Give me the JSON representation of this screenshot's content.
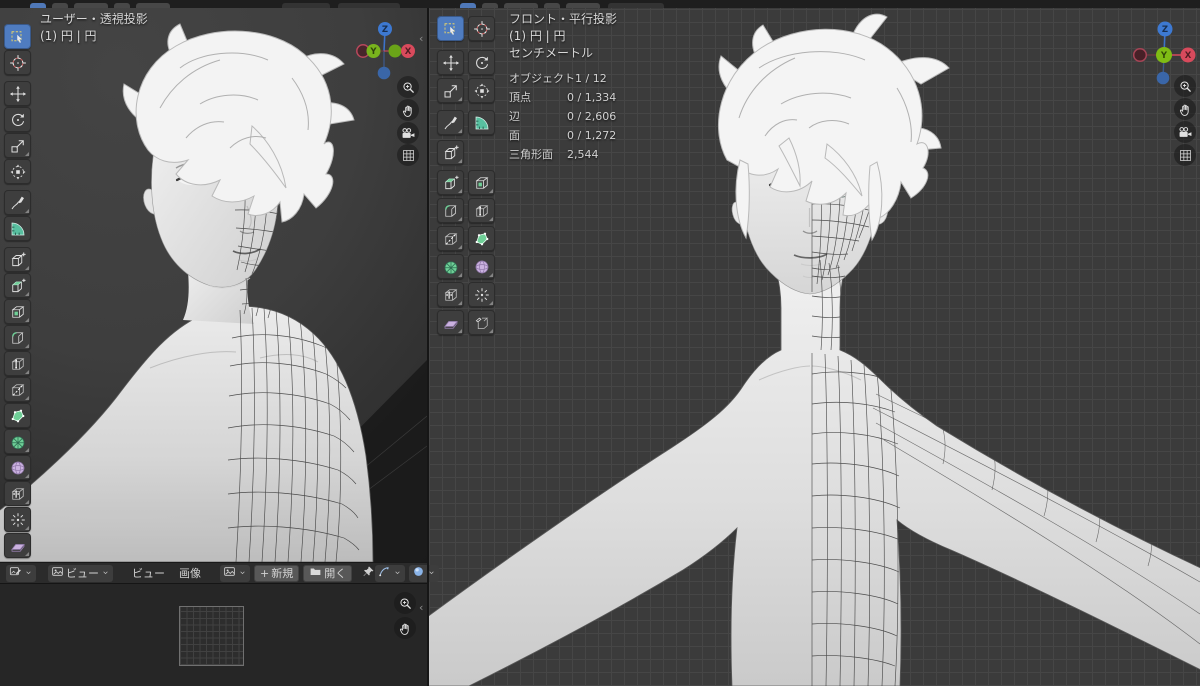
{
  "left_viewport": {
    "title": "ユーザー・透視投影",
    "subtitle": "(1) 円 | 円"
  },
  "right_viewport": {
    "title": "フロント・平行投影",
    "subtitle": "(1) 円 | 円",
    "unit": "センチメートル",
    "stats": [
      {
        "label": "オブジェクト",
        "value": "1 / 12"
      },
      {
        "label": "頂点",
        "value": "0 / 1,334"
      },
      {
        "label": "辺",
        "value": "0 / 2,606"
      },
      {
        "label": "面",
        "value": "0 / 1,272"
      },
      {
        "label": "三角形面",
        "value": "2,544"
      }
    ]
  },
  "gizmo": {
    "z": "Z",
    "y": "Y",
    "x": "X"
  },
  "footer": {
    "mode_dropdown": "ビュー",
    "menus": [
      {
        "label": "ビュー"
      },
      {
        "label": "画像"
      }
    ],
    "new_plus": "+",
    "new_label": "新規",
    "open_label": "開く"
  },
  "tools": {
    "left_column": [
      "select-box",
      "cursor",
      "move",
      "rotate",
      "scale",
      "transform",
      "annotate",
      "measure",
      "add-cube",
      "extrude-region",
      "inset-faces",
      "bevel",
      "loop-cut",
      "knife",
      "poly-build",
      "spin",
      "smooth",
      "edge-slide",
      "shrink-fatten",
      "shear"
    ],
    "right_extra": [
      "rip-region"
    ]
  },
  "colors": {
    "active_tool_blue": "#4f7cc0",
    "axis_x": "#d84a5c",
    "axis_y": "#7fbc14",
    "axis_z": "#3d79d2",
    "tool_green": "#6fcf97",
    "tool_purple": "#cbb2e0",
    "eye_teal": "#3f9c8c"
  }
}
